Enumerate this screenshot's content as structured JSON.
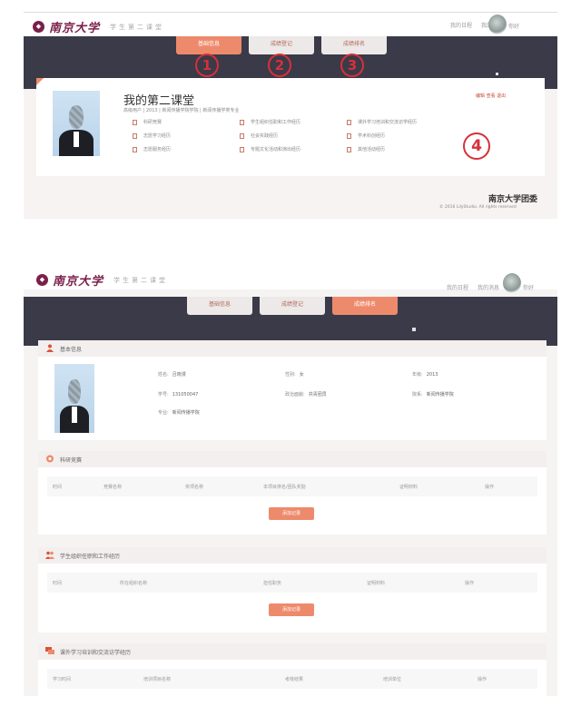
{
  "header": {
    "brand": "南京大学",
    "subtitle": "学生第二课堂",
    "links": [
      "我的日程",
      "我的消息"
    ],
    "user": "你好"
  },
  "tabs": [
    "基础信息",
    "成绩登记",
    "成绩排名"
  ],
  "circled_numbers": [
    "1",
    "2",
    "3",
    "4"
  ],
  "profile_panel": {
    "title": "我的第二课堂",
    "breadcrumb": "高级用户 | 2013 | 新闻传播学院学院 | 新闻传播学类专业",
    "edit": "编辑 查看 退出",
    "links": [
      "科研竞赛",
      "学生组织任职和工作经历",
      "课外学习培训和交流访学经历",
      "志愿学习经历",
      "社会实践经历",
      "学术科创经历",
      "志愿服务经历",
      "专题文化活动和演出经历",
      "其他活动经历"
    ]
  },
  "footer": {
    "org": "南京大学团委",
    "copyright": "© 2016 LilyStudio. All rights reserved"
  },
  "basic_info": {
    "title": "基本信息",
    "fields": [
      {
        "label": "姓名",
        "value": "吕晓漫"
      },
      {
        "label": "性别",
        "value": "女"
      },
      {
        "label": "年级",
        "value": "2013"
      },
      {
        "label": "学号",
        "value": "131050047"
      },
      {
        "label": "政治面貌",
        "value": "共青团员"
      },
      {
        "label": "院系",
        "value": "新闻传播学院"
      },
      {
        "label": "专业",
        "value": "新闻传播学院"
      }
    ]
  },
  "sections": [
    {
      "title": "科研竞赛",
      "columns": [
        "时间",
        "竞赛名称",
        "奖项名称",
        "本项目排名/团队奖励",
        "证明材料",
        "操作"
      ],
      "button": "添加记录"
    },
    {
      "title": "学生组织任职和工作经历",
      "columns": [
        "时间",
        "所在组织名称",
        "担任职务",
        "证明材料",
        "操作"
      ],
      "button": "添加记录"
    },
    {
      "title": "课外学习培训和交流访学经历",
      "columns": [
        "学习时间",
        "培训项目名称",
        "考核结果",
        "培训单位",
        "操作"
      ],
      "button": ""
    }
  ]
}
